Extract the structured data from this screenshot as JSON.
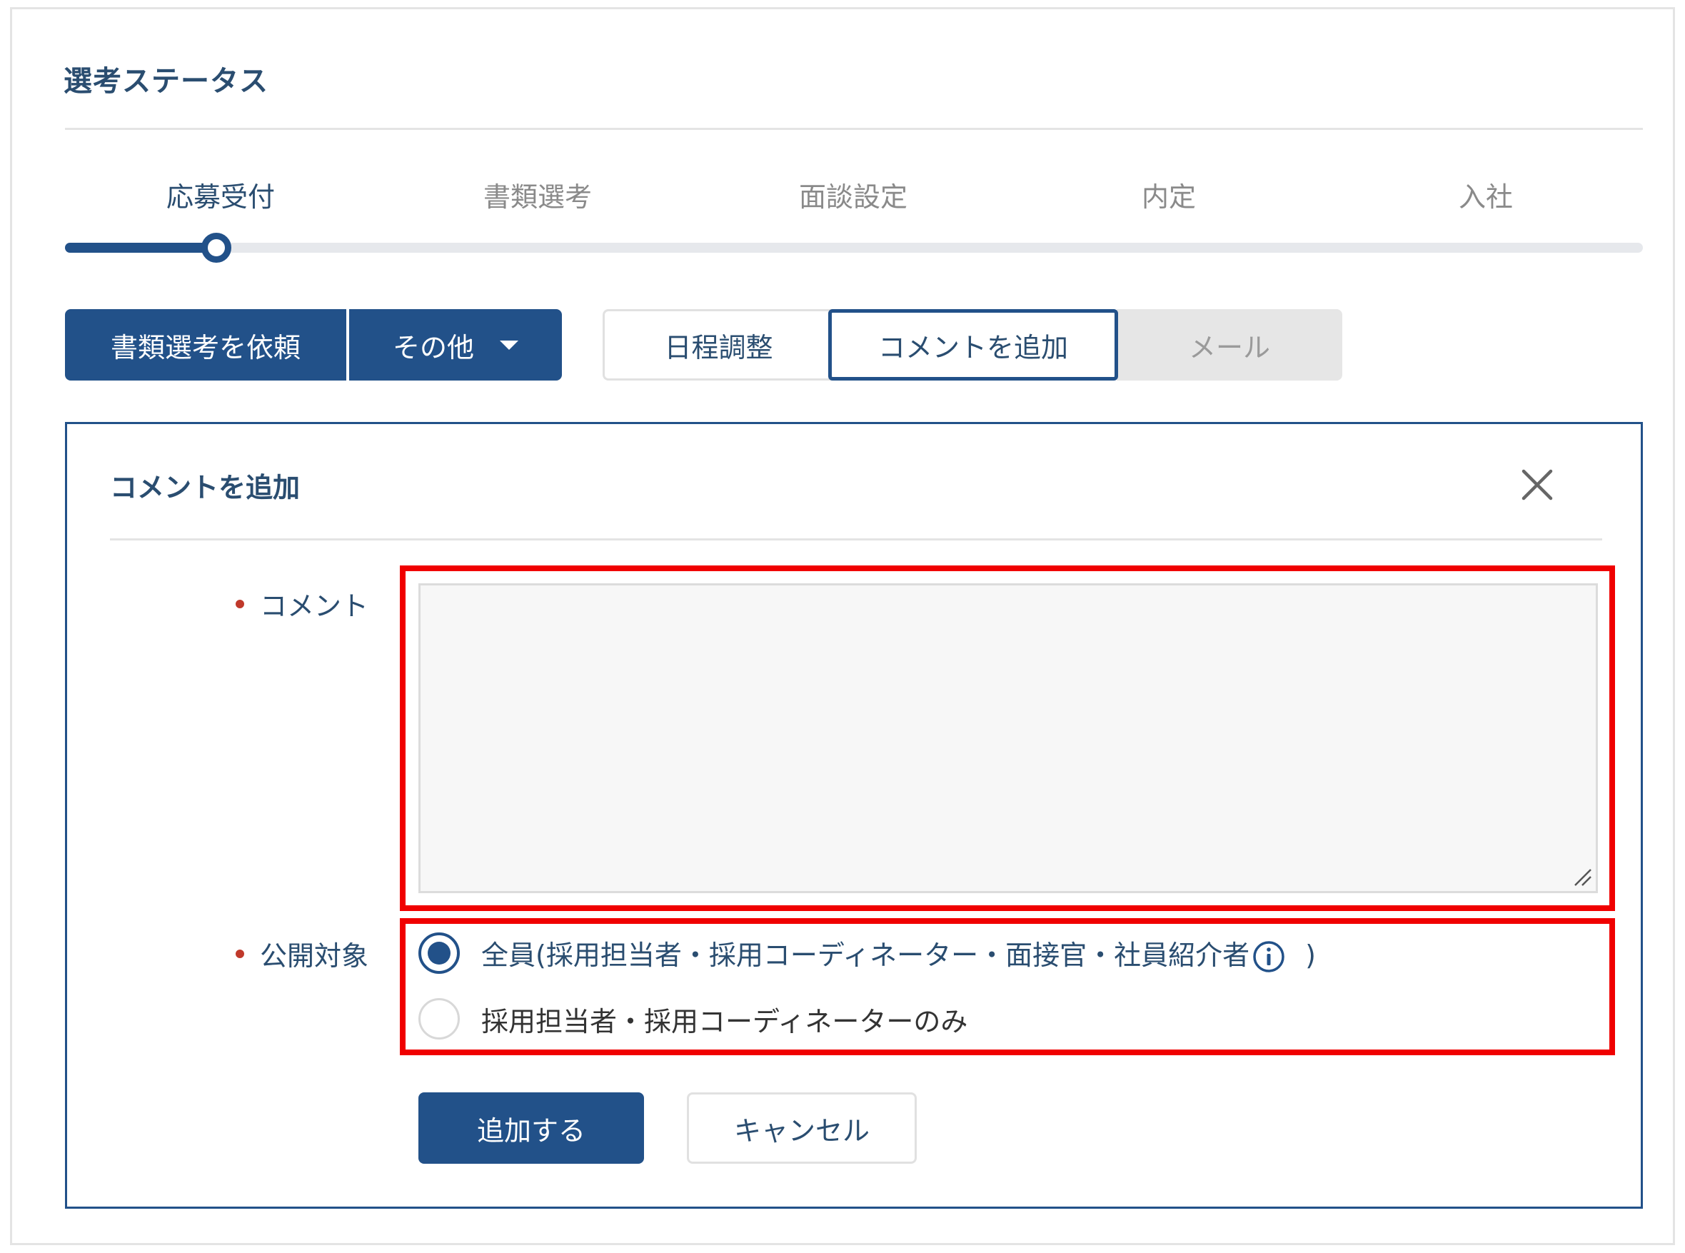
{
  "header": {
    "title": "選考ステータス"
  },
  "stepper": {
    "steps": [
      {
        "label": "応募受付",
        "active": true
      },
      {
        "label": "書類選考",
        "active": false
      },
      {
        "label": "面談設定",
        "active": false
      },
      {
        "label": "内定",
        "active": false
      },
      {
        "label": "入社",
        "active": false
      }
    ],
    "current_step": 1,
    "total_steps": 5
  },
  "actions": {
    "request_label": "書類選考を依頼",
    "other_label": "その他",
    "schedule_label": "日程調整",
    "comment_label": "コメントを追加",
    "mail_label": "メール"
  },
  "panel": {
    "title": "コメントを追加",
    "comment_label": "コメント",
    "comment_value": "",
    "visibility_label": "公開対象",
    "visibility_options": [
      {
        "label": "全員(採用担当者・採用コーディネーター・面接官・社員紹介者",
        "suffix": ")",
        "selected": true
      },
      {
        "label": "採用担当者・採用コーディネーターのみ",
        "selected": false
      }
    ],
    "submit_label": "追加する",
    "cancel_label": "キャンセル"
  },
  "colors": {
    "primary": "#225189",
    "heading": "#2a4d70",
    "highlight": "#f00000",
    "required": "#c0392b",
    "muted": "#8a8a8a"
  }
}
